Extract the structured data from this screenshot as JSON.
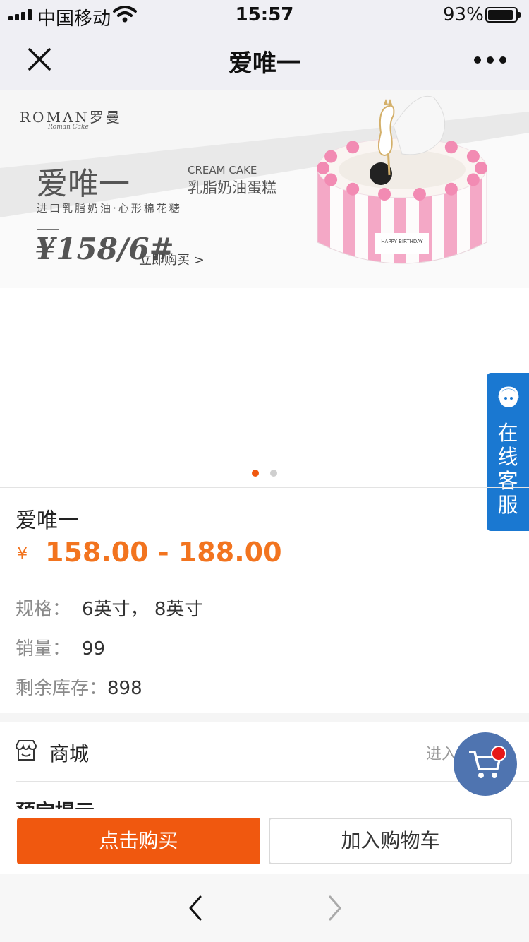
{
  "status_bar": {
    "carrier": "中国移动",
    "time": "15:57",
    "battery": "93%",
    "battery_level": 0.93
  },
  "nav": {
    "title": "爱唯一",
    "close_icon": "close-icon",
    "more_icon": "more-icon"
  },
  "banner": {
    "brand": "ROMAN罗曼",
    "brand_sub": "Roman Cake",
    "title": "爱唯一",
    "desc": "进口乳脂奶油·心形棉花糖",
    "price": "¥158/6#",
    "buy_now": "立即购买 >",
    "cream_en": "CREAM CAKE",
    "cream_cn": "乳脂奶油蛋糕",
    "cake_text": "HAPPY BIRTHDAY",
    "slide_count": 2,
    "active_slide": 1
  },
  "service": {
    "label": "在线客服"
  },
  "product": {
    "name": "爱唯一",
    "currency": "¥",
    "price_range": "158.00 - 188.00",
    "specs": [
      {
        "key": "规格：",
        "value": "6英寸， 8英寸"
      },
      {
        "key": "销量：",
        "value": "99"
      },
      {
        "key": "剩余库存：",
        "value": "898"
      }
    ]
  },
  "shop": {
    "label": "商城",
    "enter": "进入店铺 >"
  },
  "notice": {
    "title": "预定提示"
  },
  "actions": {
    "buy": "点击购买",
    "add_cart": "加入购物车"
  },
  "colors": {
    "accent": "#f0580f",
    "price": "#f2741f",
    "service": "#1a78d1",
    "cart_fab": "#4f74b0"
  }
}
